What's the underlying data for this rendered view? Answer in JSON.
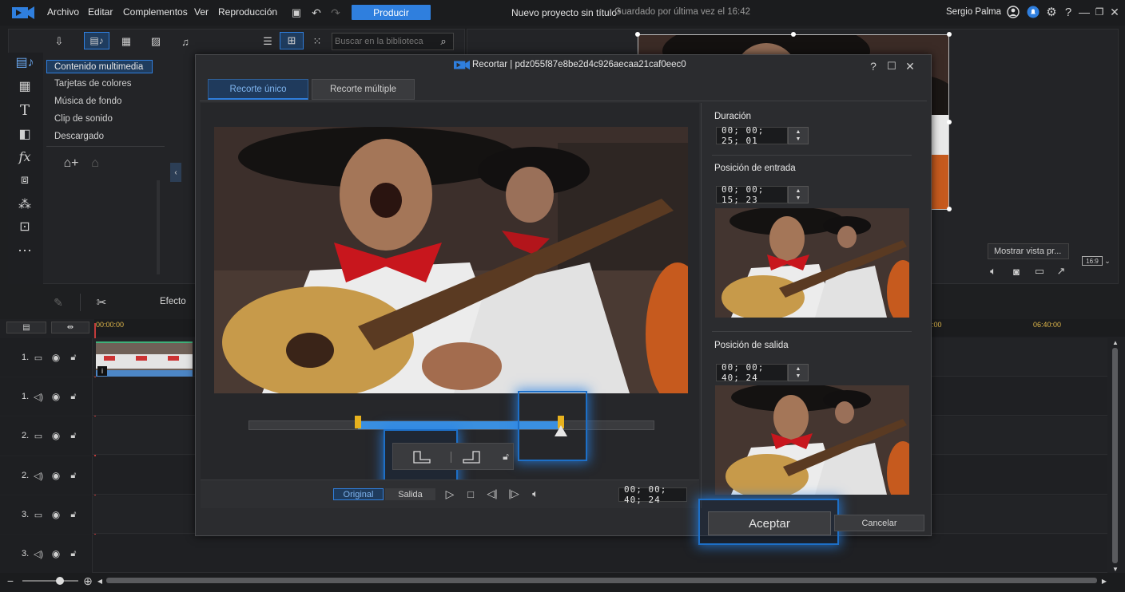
{
  "menubar": {
    "items": [
      "Archivo",
      "Editar",
      "Complementos",
      "Ver",
      "Reproducción"
    ],
    "produce": "Producir",
    "project_title": "Nuevo proyecto sin título*",
    "saved_status": "Guardado por última vez el 16:42",
    "user": "Sergio Palma"
  },
  "library": {
    "search_placeholder": "Buscar en la biblioteca",
    "items": [
      "Contenido multimedia",
      "Tarjetas de colores",
      "Música de fondo",
      "Clip de sonido",
      "Descargado"
    ]
  },
  "preview": {
    "show_preview": "Mostrar vista pr...",
    "aspect": "16:9"
  },
  "timeline": {
    "effect_label": "Efecto",
    "time_start": "00:00:00",
    "time_marker_a": ":00",
    "time_marker_b": "06:40:00",
    "tracks": [
      "1.",
      "1.",
      "2.",
      "2.",
      "3.",
      "3."
    ]
  },
  "dialog": {
    "title": "Recortar | pdz055f87e8be2d4c926aecaa21caf0eec0",
    "tabs": [
      "Recorte único",
      "Recorte múltiple"
    ],
    "duration_label": "Duración",
    "duration_value": "00; 00; 25; 01",
    "in_label": "Posición de entrada",
    "in_value": "00; 00; 15; 23",
    "out_label": "Posición de salida",
    "out_value": "00; 00; 40; 24",
    "mode_original": "Original",
    "mode_output": "Salida",
    "current_time": "00; 00; 40; 24",
    "accept": "Aceptar",
    "cancel": "Cancelar",
    "trim_selection": {
      "start": 0.27,
      "end": 0.77
    }
  },
  "colors": {
    "accent": "#2f7fde",
    "trim_bar": "#3a8fe0",
    "handle": "#e8b21e",
    "glow": "#1d6fc7"
  }
}
